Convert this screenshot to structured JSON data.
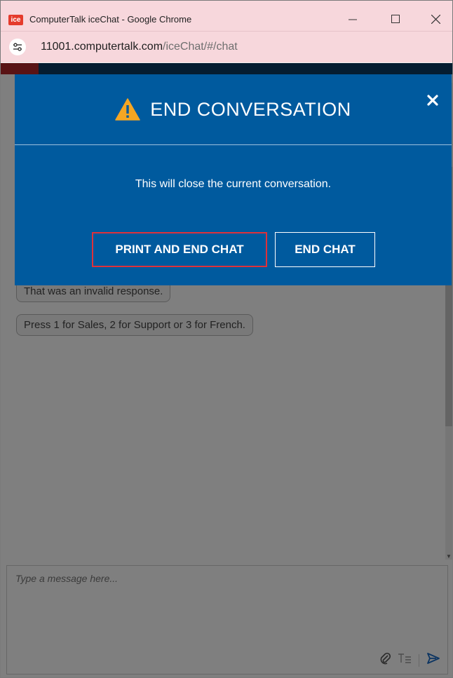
{
  "window": {
    "title": "ComputerTalk iceChat - Google Chrome",
    "app_icon_label": "ice",
    "minimize_icon": "minimize-icon",
    "maximize_icon": "maximize-icon",
    "close_icon": "close-icon"
  },
  "address": {
    "host": "11001.computertalk.com",
    "path": "/iceChat/#/chat",
    "site_info_icon": "site-settings-icon"
  },
  "chat": {
    "messages": [
      "That was an invalid response.",
      "Press 1 for Sales, 2 for Support or 3 for French."
    ]
  },
  "composer": {
    "placeholder": "Type a message here...",
    "attach_icon": "paperclip-icon",
    "format_icon": "text-format-icon",
    "send_icon": "send-icon"
  },
  "modal": {
    "title": "END CONVERSATION",
    "warning_icon": "warning-icon",
    "close_icon": "close-icon",
    "message": "This will close the current conversation.",
    "print_end_label": "PRINT AND END CHAT",
    "end_label": "END CHAT"
  },
  "colors": {
    "modal_bg": "#005a9e",
    "warning": "#f5a623",
    "highlight": "#e0313a",
    "browser_chrome": "#f7d7dc"
  }
}
